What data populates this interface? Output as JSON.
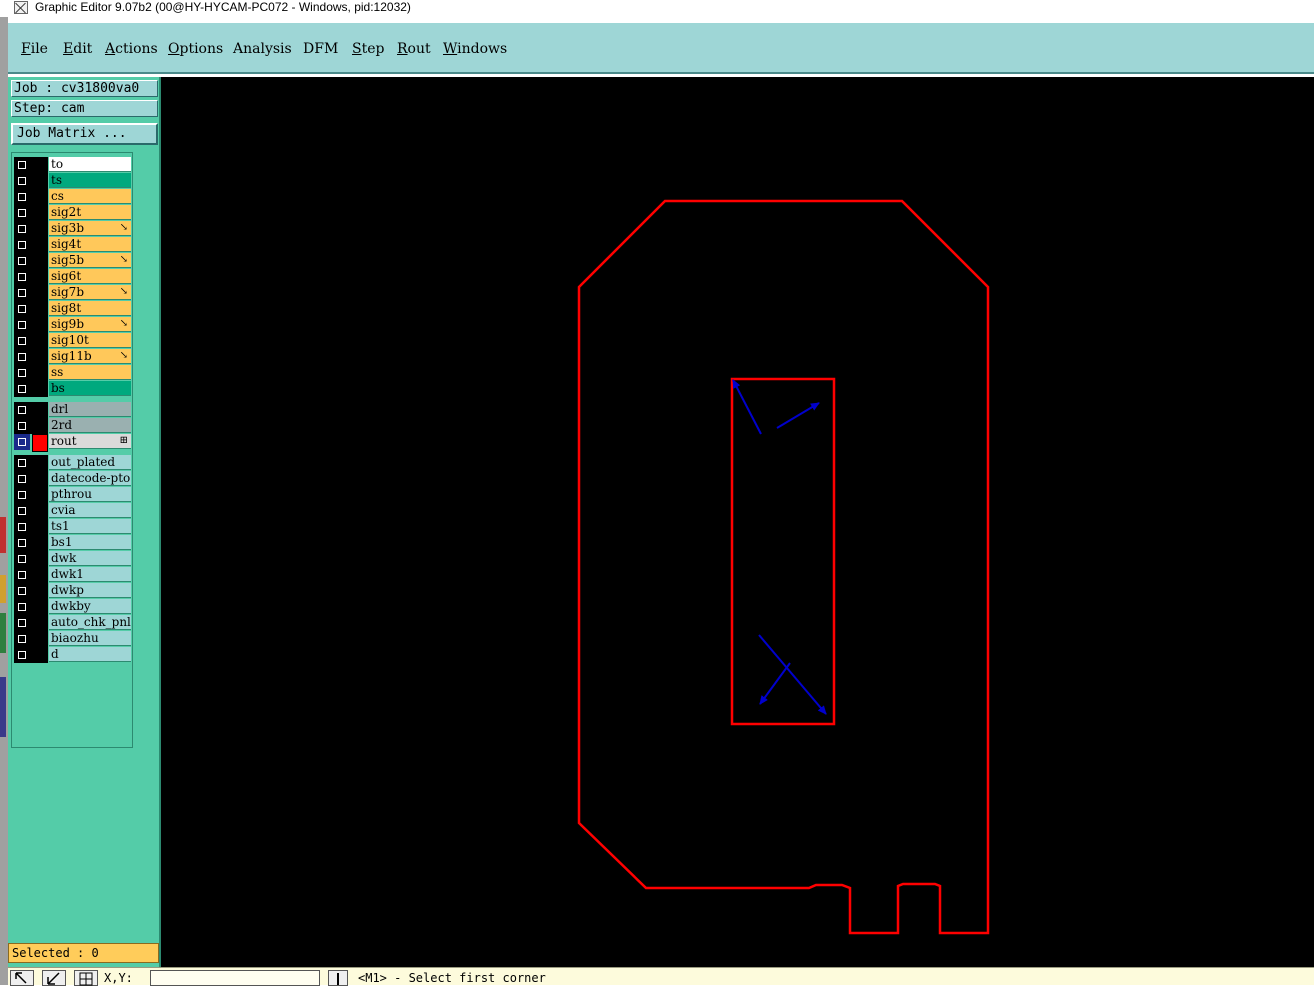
{
  "window": {
    "title": "Graphic Editor 9.07b2 (00@HY-HYCAM-PC072 - Windows, pid:12032)"
  },
  "menu": [
    {
      "label": "File",
      "underline": "F",
      "rest": "ile"
    },
    {
      "label": "Edit",
      "underline": "E",
      "rest": "dit"
    },
    {
      "label": "Actions",
      "underline": "A",
      "rest": "ctions"
    },
    {
      "label": "Options",
      "underline": "O",
      "rest": "ptions"
    },
    {
      "label": "Analysis",
      "underline": "",
      "rest": "Analysis"
    },
    {
      "label": "DFM",
      "underline": "",
      "rest": "DFM"
    },
    {
      "label": "Step",
      "underline": "S",
      "rest": "tep"
    },
    {
      "label": "Rout",
      "underline": "R",
      "rest": "out"
    },
    {
      "label": "Windows",
      "underline": "W",
      "rest": "indows"
    }
  ],
  "panel": {
    "job": "Job : cv31800va0",
    "step": "Step: cam",
    "job_matrix": "Job Matrix ...",
    "selected": "Selected : 0"
  },
  "layers": [
    {
      "name": "to",
      "color": "#ffffff",
      "mark": ""
    },
    {
      "name": "ts",
      "color": "#00a97e",
      "mark": ""
    },
    {
      "name": "cs",
      "color": "#ffc85a",
      "mark": ""
    },
    {
      "name": "sig2t",
      "color": "#ffc85a",
      "mark": ""
    },
    {
      "name": "sig3b",
      "color": "#ffc85a",
      "mark": "↘"
    },
    {
      "name": "sig4t",
      "color": "#ffc85a",
      "mark": ""
    },
    {
      "name": "sig5b",
      "color": "#ffc85a",
      "mark": "↘"
    },
    {
      "name": "sig6t",
      "color": "#ffc85a",
      "mark": ""
    },
    {
      "name": "sig7b",
      "color": "#ffc85a",
      "mark": "↘"
    },
    {
      "name": "sig8t",
      "color": "#ffc85a",
      "mark": ""
    },
    {
      "name": "sig9b",
      "color": "#ffc85a",
      "mark": "↘"
    },
    {
      "name": "sig10t",
      "color": "#ffc85a",
      "mark": ""
    },
    {
      "name": "sig11b",
      "color": "#ffc85a",
      "mark": "↘"
    },
    {
      "name": "ss",
      "color": "#ffc85a",
      "mark": ""
    },
    {
      "name": "bs",
      "color": "#00a97e",
      "mark": ""
    },
    {
      "name": "drl",
      "color": "#9ab0b0",
      "mark": ""
    },
    {
      "name": "2rd",
      "color": "#9ab0b0",
      "mark": ""
    },
    {
      "name": "rout",
      "color": "#dadada",
      "mark": "⊞",
      "active": true
    },
    {
      "name": "out_plated",
      "color": "#9ed6d6",
      "mark": ""
    },
    {
      "name": "datecode-pto",
      "color": "#9ed6d6",
      "mark": ""
    },
    {
      "name": "pthrou",
      "color": "#9ed6d6",
      "mark": ""
    },
    {
      "name": "cvia",
      "color": "#9ed6d6",
      "mark": ""
    },
    {
      "name": "ts1",
      "color": "#9ed6d6",
      "mark": ""
    },
    {
      "name": "bs1",
      "color": "#9ed6d6",
      "mark": ""
    },
    {
      "name": "dwk",
      "color": "#9ed6d6",
      "mark": ""
    },
    {
      "name": "dwk1",
      "color": "#9ed6d6",
      "mark": ""
    },
    {
      "name": "dwkp",
      "color": "#9ed6d6",
      "mark": ""
    },
    {
      "name": "dwkby",
      "color": "#9ed6d6",
      "mark": ""
    },
    {
      "name": "auto_chk_pnl",
      "color": "#9ed6d6",
      "mark": ""
    },
    {
      "name": "biaozhu",
      "color": "#9ed6d6",
      "mark": ""
    },
    {
      "name": "d",
      "color": "#9ed6d6",
      "mark": ""
    }
  ],
  "status": {
    "xy_label": "X,Y:",
    "prompt": "<M1> - Select first corner"
  },
  "canvas": {
    "background": "#000000",
    "outline_color": "#ff0000",
    "arrow_color": "#0000cc"
  }
}
